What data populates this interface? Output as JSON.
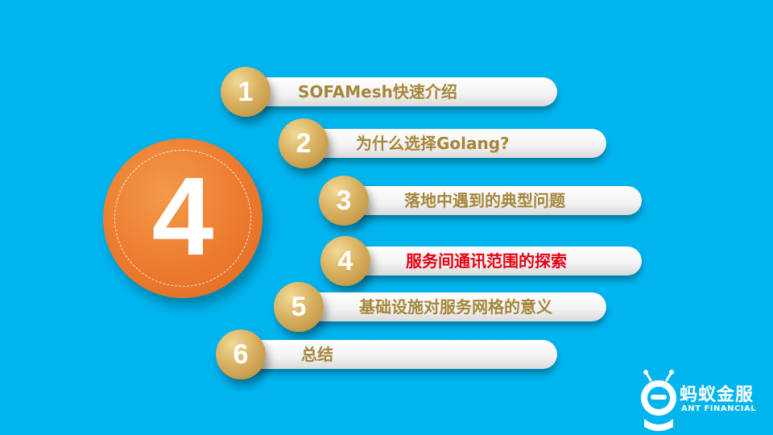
{
  "section_number": "4",
  "agenda": [
    {
      "number": "1",
      "label": "SOFAMesh快速介绍",
      "active": false
    },
    {
      "number": "2",
      "label": "为什么选择Golang?",
      "active": false
    },
    {
      "number": "3",
      "label": "落地中遇到的典型问题",
      "active": false
    },
    {
      "number": "4",
      "label": "服务间通讯范围的探索",
      "active": true
    },
    {
      "number": "5",
      "label": "基础设施对服务网格的意义",
      "active": false
    },
    {
      "number": "6",
      "label": "总结",
      "active": false
    }
  ],
  "logo": {
    "name_cn": "蚂蚁金服",
    "name_en": "ANT FINANCIAL",
    "icon": "ant-logo-icon"
  },
  "colors": {
    "background": "#00B4EE",
    "circle": "#EC7A2E",
    "badge": "#D8B160",
    "label": "#A6863A",
    "active_label": "#E60012"
  }
}
